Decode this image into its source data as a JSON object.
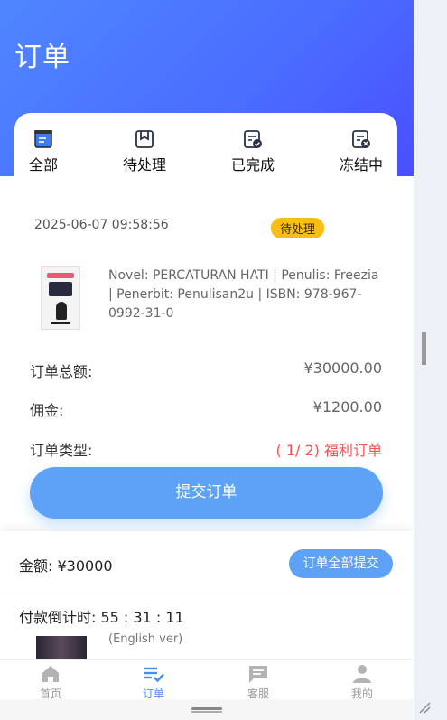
{
  "header": {
    "title": "订单"
  },
  "tabs": [
    {
      "label": "全部",
      "icon": "all-orders-icon"
    },
    {
      "label": "待处理",
      "icon": "pending-icon"
    },
    {
      "label": "已完成",
      "icon": "completed-icon"
    },
    {
      "label": "冻结中",
      "icon": "frozen-icon"
    }
  ],
  "order": {
    "datetime": "2025-06-07 09:58:56",
    "status": "待处理",
    "description": "Novel: PERCATURAN HATI | Penulis: Freezia | Penerbit: Penulisan2u | ISBN: 978-967-0992-31-0",
    "total_label": "订单总额:",
    "total_value": "¥30000.00",
    "commission_label": "佣金:",
    "commission_value": "¥1200.00",
    "type_label": "订单类型:",
    "type_value": "( 1/ 2) 福利订单",
    "submit_label": "提交订单"
  },
  "summary": {
    "amount_text": "金额: ¥30000",
    "submit_all_label": "订单全部提交",
    "countdown_text": "付款倒计时:  55 : 31 : 11"
  },
  "peek_item": {
    "text": "(English ver)"
  },
  "bottom_nav": [
    {
      "label": "首页",
      "icon": "home-icon"
    },
    {
      "label": "订单",
      "icon": "orders-icon"
    },
    {
      "label": "客服",
      "icon": "chat-icon"
    },
    {
      "label": "我的",
      "icon": "profile-icon"
    }
  ],
  "colors": {
    "header_gradient_start": "#4f86ff",
    "header_gradient_end": "#4a4aff",
    "accent_blue": "#5ea2f8",
    "status_badge": "#f9bd16",
    "order_type_red": "#ff4d4f",
    "active_nav": "#4a8cf7"
  }
}
